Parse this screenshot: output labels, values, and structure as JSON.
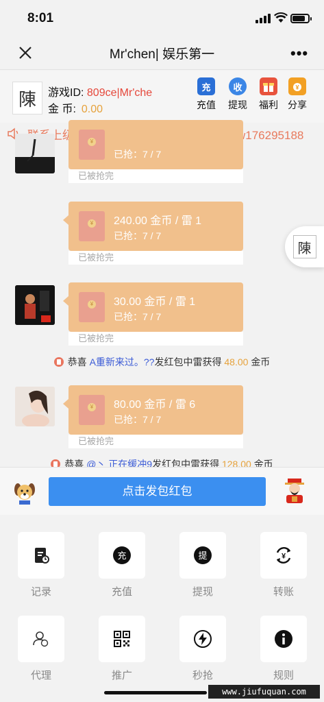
{
  "status": {
    "time": "8:01"
  },
  "nav": {
    "title": "Mr'chen| 娱乐第一"
  },
  "account": {
    "id_label": "游戏ID:",
    "id_value": "809ce|Mr'che",
    "gold_label": "金 币:",
    "gold_value": "0.00"
  },
  "actions": [
    {
      "label": "充值",
      "icon": "recharge-icon",
      "color": "#2a6fd6"
    },
    {
      "label": "提现",
      "icon": "withdraw-icon",
      "color": "#3b86e6"
    },
    {
      "label": "福利",
      "icon": "gift-icon",
      "color": "#e8533d"
    },
    {
      "label": "分享",
      "icon": "share-icon",
      "color": "#f2a024"
    }
  ],
  "marquee": {
    "text": "联系上级推广员或在线客服。微信客服：w176295188"
  },
  "messages": [
    {
      "amount": "",
      "grabbed": "已抢：7 / 7",
      "footer": "已被抢完"
    },
    {
      "amount": "240.00 金币 / 雷 1",
      "grabbed": "已抢：7 / 7",
      "footer": "已被抢完"
    },
    {
      "amount": "30.00 金币 / 雷 1",
      "grabbed": "已抢：7 / 7",
      "footer": "已被抢完"
    },
    {
      "amount": "80.00 金币 / 雷 6",
      "grabbed": "已抢：7 / 7",
      "footer": "已被抢完"
    }
  ],
  "system": [
    {
      "prefix": "恭喜",
      "name": "A重新来过。??",
      "middle": "发红包中雷获得",
      "amount": "48.00",
      "suffix": "金币"
    },
    {
      "prefix": "恭喜",
      "name": "@丶 正在缓冲9",
      "middle": "发红包中雷获得",
      "amount": "128.00",
      "suffix": "金币"
    }
  ],
  "send_button": "点击发包红包",
  "grid": [
    {
      "label": "记录",
      "icon": "record-icon"
    },
    {
      "label": "充值",
      "icon": "recharge-icon"
    },
    {
      "label": "提现",
      "icon": "withdraw-icon"
    },
    {
      "label": "转账",
      "icon": "transfer-icon"
    },
    {
      "label": "代理",
      "icon": "agent-icon"
    },
    {
      "label": "推广",
      "icon": "qrcode-icon"
    },
    {
      "label": "秒抢",
      "icon": "lightning-icon"
    },
    {
      "label": "规则",
      "icon": "info-icon"
    }
  ],
  "watermark": "www.jiufuquan.com"
}
